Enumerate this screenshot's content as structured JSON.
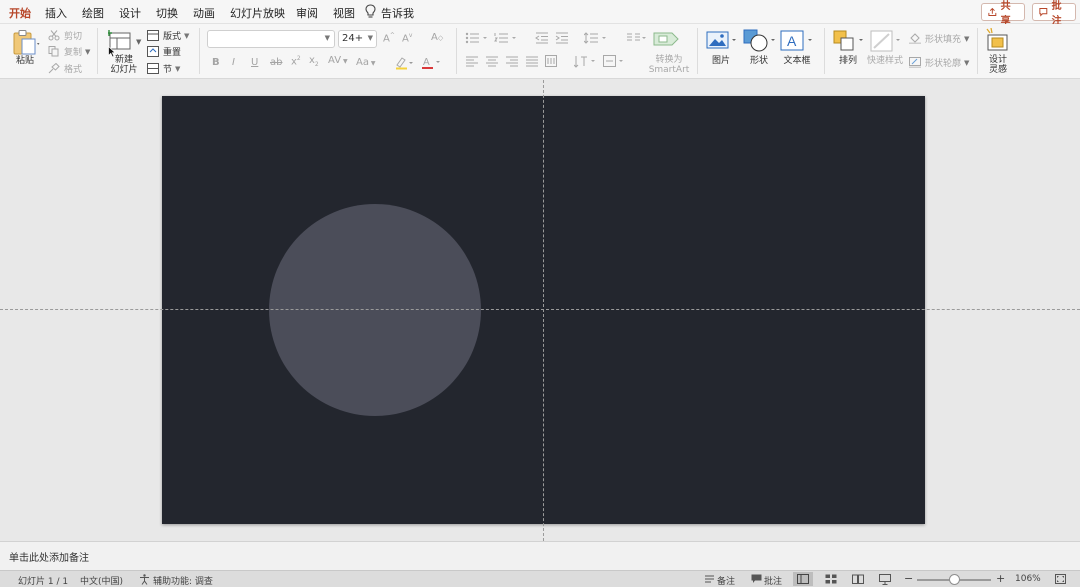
{
  "menu_tabs": [
    {
      "label": "开始",
      "active": true
    },
    {
      "label": "插入"
    },
    {
      "label": "绘图"
    },
    {
      "label": "设计"
    },
    {
      "label": "切换"
    },
    {
      "label": "动画"
    },
    {
      "label": "幻灯片放映"
    },
    {
      "label": "审阅"
    },
    {
      "label": "视图"
    }
  ],
  "tell_me": "告诉我",
  "header_buttons": {
    "share": "共享",
    "comments": "批注"
  },
  "ribbon": {
    "paste": "粘贴",
    "cut": "剪切",
    "copy": "复制",
    "format": "格式",
    "new_slide_line1": "新建",
    "new_slide_line2": "幻灯片",
    "layout": "版式",
    "reset": "重置",
    "section": "节",
    "font_name": "",
    "font_size": "24+",
    "convert_smartart_line1": "转换为",
    "convert_smartart_line2": "SmartArt",
    "picture": "图片",
    "shapes": "形状",
    "textbox": "文本框",
    "arrange": "排列",
    "quick_styles": "快速样式",
    "shape_fill": "形状填充",
    "shape_outline": "形状轮廓",
    "designer_line1": "设计",
    "designer_line2": "灵感"
  },
  "notes_placeholder": "单击此处添加备注",
  "status": {
    "slide_counter": "幻灯片 1 / 1",
    "language": "中文(中国)",
    "accessibility": "辅助功能: 调查",
    "notes": "备注",
    "comments": "批注",
    "zoom_minus": "−",
    "zoom_plus": "+",
    "zoom": "106%"
  },
  "colors": {
    "accent": "#b7472a",
    "slide_background": "#23262e",
    "circle_fill": "#4b4d59"
  }
}
